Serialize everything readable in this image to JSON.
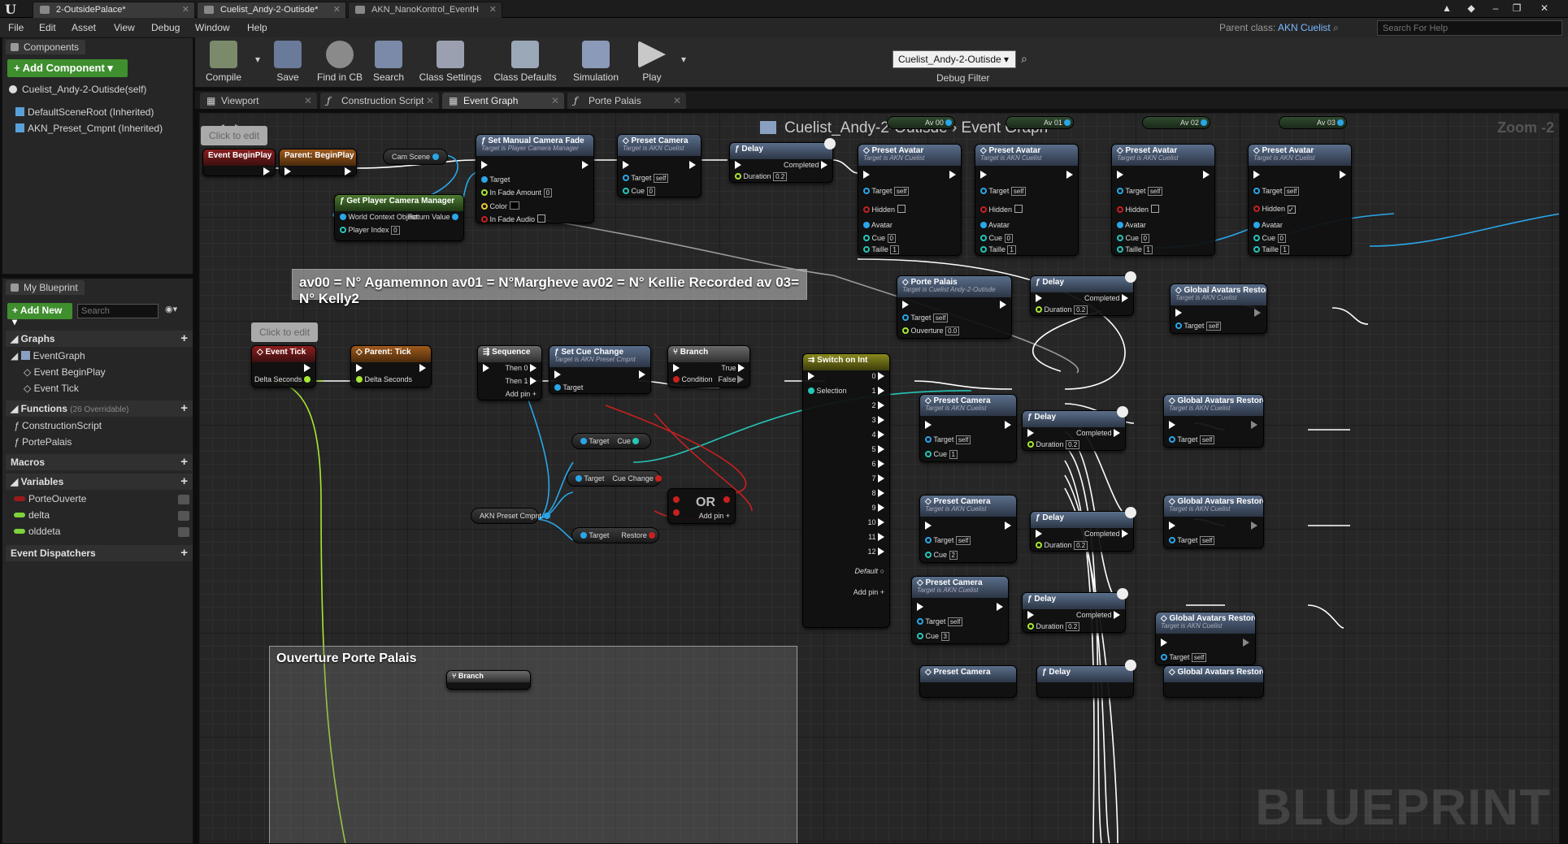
{
  "window": {
    "tabs": [
      {
        "label": "2-OutsidePalace*"
      },
      {
        "label": "Cuelist_Andy-2-Outisde*"
      },
      {
        "label": "AKN_NanoKontrol_EventH"
      }
    ]
  },
  "menu": [
    "File",
    "Edit",
    "Asset",
    "View",
    "Debug",
    "Window",
    "Help"
  ],
  "header": {
    "parent_class_label": "Parent class:",
    "parent_class_value": "AKN Cuelist",
    "help_placeholder": "Search For Help"
  },
  "components": {
    "tab_label": "Components",
    "add_button": "+ Add Component ▾",
    "items": [
      "Cuelist_Andy-2-Outisde(self)",
      "DefaultSceneRoot (Inherited)",
      "AKN_Preset_Cmpnt (Inherited)"
    ]
  },
  "my_blueprint": {
    "tab_label": "My Blueprint",
    "add_new": "+ Add New ▾",
    "search_placeholder": "Search",
    "sections": {
      "graphs": "Graphs",
      "functions": "Functions",
      "functions_note": "(26 Overridable)",
      "macros": "Macros",
      "variables": "Variables",
      "dispatchers": "Event Dispatchers"
    },
    "graph_items": [
      "EventGraph",
      "Event BeginPlay",
      "Event Tick"
    ],
    "function_items": [
      "ConstructionScript",
      "PortePalais"
    ],
    "variables": [
      {
        "name": "PorteOuverte",
        "color": "#9b1a1a"
      },
      {
        "name": "delta",
        "color": "#7ed33a"
      },
      {
        "name": "olddeta",
        "color": "#7ed33a"
      }
    ]
  },
  "toolbar": {
    "compile": "Compile",
    "save": "Save",
    "find": "Find in CB",
    "search": "Search",
    "class_settings": "Class Settings",
    "class_defaults": "Class Defaults",
    "simulation": "Simulation",
    "play": "Play",
    "debug_object": "Cuelist_Andy-2-Outisde ▾",
    "debug_filter": "Debug Filter"
  },
  "graph_tabs": [
    "Viewport",
    "Construction Script",
    "Event Graph",
    "Porte Palais"
  ],
  "graph": {
    "breadcrumb_root": "Cuelist_Andy-2-Outisde",
    "breadcrumb_sep": "›",
    "breadcrumb_current": "Event Graph",
    "zoom": "Zoom -2",
    "watermark": "BLUEPRINT",
    "click_to_edit": "Click to edit",
    "comment_avatars": "av00 = N° Agamemnon av01 = N°Margheve av02 = N° Kellie Recorded av 03= N° Kelly2",
    "comment_ouverture": "Ouverture Porte Palais",
    "nodes": {
      "begin_play": "Event BeginPlay",
      "parent_begin_play": "Parent: BeginPlay",
      "cam_scene": "Cam Scene",
      "get_camera_manager": "Get Player Camera Manager",
      "world_context": "World Context Object",
      "return_value": "Return Value",
      "player_index": "Player Index",
      "set_fade": "Set Manual Camera Fade",
      "set_fade_sub": "Target is Player Camera Manager",
      "target": "Target",
      "fade_amount": "In Fade Amount",
      "color": "Color",
      "fade_audio": "In Fade Audio",
      "preset_camera": "Preset Camera",
      "target_cuelist": "Target is AKN Cuelist",
      "cue": "Cue",
      "self": "self",
      "delay": "Delay",
      "completed": "Completed",
      "duration": "Duration",
      "preset_avatar": "Preset Avatar",
      "hidden": "Hidden",
      "avatar": "Avatar",
      "taille": "Taille",
      "av_vars": [
        "Av 00",
        "Av 01",
        "Av 02",
        "Av 03"
      ],
      "porte_palais": "Porte Palais",
      "porte_palais_sub": "Target is Cuelist Andy-2-Outisde",
      "ouverture": "Ouverture",
      "global_restore": "Global Avatars Restore",
      "event_tick": "Event Tick",
      "delta_seconds": "Delta Seconds",
      "parent_tick": "Parent: Tick",
      "sequence": "Sequence",
      "then0": "Then 0",
      "then1": "Then 1",
      "add_pin": "Add pin",
      "set_cue_change": "Set Cue Change",
      "target_preset_cmpnt": "Target is AKN Preset Cmpnt",
      "branch": "Branch",
      "true": "True",
      "false": "False",
      "condition": "Condition",
      "switch_on_int": "Switch on Int",
      "selection": "Selection",
      "default": "Default",
      "cue_change": "Cue Change",
      "restore": "Restore",
      "or": "OR",
      "akn_preset_cmpnt": "AKN Preset Cmpnt",
      "global_restore_partial": "Global Avatars Restore"
    },
    "values": {
      "fade_amount": "0",
      "cue0": "0",
      "delay_top": "0.2",
      "delay_mid": "0.2",
      "ouverture": "0.0",
      "player_index": "0",
      "cue1": "1",
      "cue2": "2",
      "cue3": "3",
      "taille": "1",
      "switch_pins": [
        "0",
        "1",
        "2",
        "3",
        "4",
        "5",
        "6",
        "7",
        "8",
        "9",
        "10",
        "11",
        "12"
      ]
    }
  }
}
